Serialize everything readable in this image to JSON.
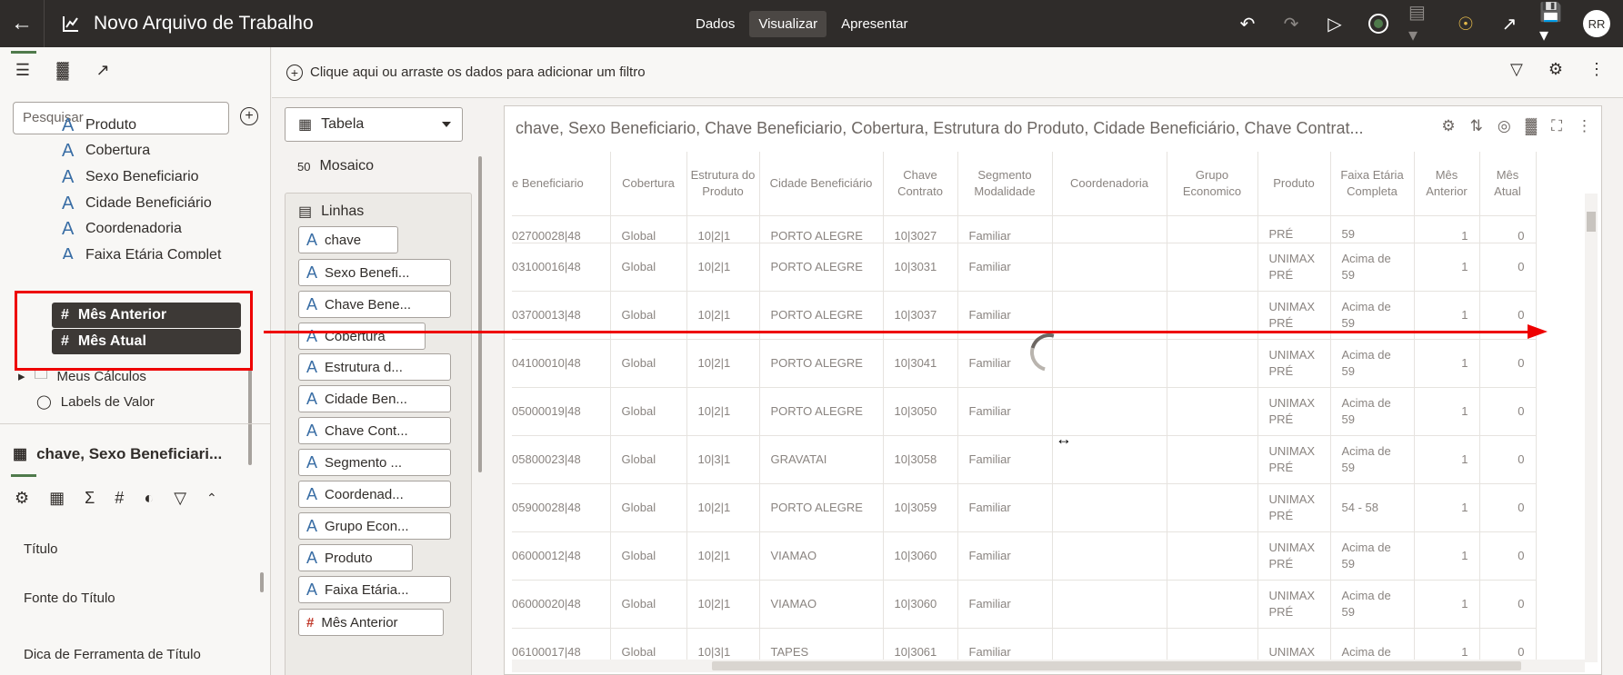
{
  "topbar": {
    "title": "Novo Arquivo de Trabalho",
    "tabs": [
      "Dados",
      "Visualizar",
      "Apresentar"
    ],
    "active_tab": "Visualizar",
    "avatar": "RR"
  },
  "left_panel": {
    "search_placeholder": "Pesquisar",
    "attributes": [
      "Produto",
      "Cobertura",
      "Sexo Beneficiario",
      "Cidade Beneficiário",
      "Coordenadoria",
      "Faixa Etária Complet"
    ],
    "measures": [
      "Mês Anterior",
      "Mês Atual"
    ],
    "folders": [
      "Meus Cálculos",
      "Labels de Valor"
    ],
    "viz_name": "chave, Sexo Beneficiari...",
    "properties": [
      "Título",
      "Fonte do Título",
      "Dica de Ferramenta de Título"
    ]
  },
  "filterbar": {
    "text": "Clique aqui ou arraste os dados para adicionar um filtro"
  },
  "grammar": {
    "viz_type": "Tabela",
    "mosaic_label": "Mosaico",
    "rows_label": "Linhas",
    "row_chips": [
      "chave",
      "Sexo Benefi...",
      "Chave Bene...",
      "Cobertura",
      "Estrutura d...",
      "Cidade Ben...",
      "Chave Cont...",
      "Segmento ...",
      "Coordenad...",
      "Grupo Econ...",
      "Produto",
      "Faixa Etária...",
      "Mês Anterior"
    ]
  },
  "canvas": {
    "title": "chave, Sexo Beneficiario, Chave Beneficiario, Cobertura, Estrutura do Produto, Cidade Beneficiário, Chave Contrat...",
    "columns": [
      {
        "label": "e Beneficiario"
      },
      {
        "label": "Cobertura"
      },
      {
        "label": "Estrutura do Produto"
      },
      {
        "label": "Cidade Beneficiário"
      },
      {
        "label": "Chave Contrato"
      },
      {
        "label": "Segmento Modalidade"
      },
      {
        "label": "Coordenadoria"
      },
      {
        "label": "Grupo Economico"
      },
      {
        "label": "Produto"
      },
      {
        "label": "Faixa Etária Completa"
      },
      {
        "label": "Mês Anterior"
      },
      {
        "label": "Mês Atual"
      }
    ],
    "rows": [
      [
        "02700028|48",
        "Global",
        "10|2|1",
        "PORTO ALEGRE",
        "10|3027",
        "Familiar",
        "",
        "",
        "PRÉ",
        "59",
        "1",
        "0"
      ],
      [
        "03100016|48",
        "Global",
        "10|2|1",
        "PORTO ALEGRE",
        "10|3031",
        "Familiar",
        "",
        "",
        "UNIMAX PRÉ",
        "Acima de 59",
        "1",
        "0"
      ],
      [
        "03700013|48",
        "Global",
        "10|2|1",
        "PORTO ALEGRE",
        "10|3037",
        "Familiar",
        "",
        "",
        "UNIMAX PRÉ",
        "Acima de 59",
        "1",
        "0"
      ],
      [
        "04100010|48",
        "Global",
        "10|2|1",
        "PORTO ALEGRE",
        "10|3041",
        "Familiar",
        "",
        "",
        "UNIMAX PRÉ",
        "Acima de 59",
        "1",
        "0"
      ],
      [
        "05000019|48",
        "Global",
        "10|2|1",
        "PORTO ALEGRE",
        "10|3050",
        "Familiar",
        "",
        "",
        "UNIMAX PRÉ",
        "Acima de 59",
        "1",
        "0"
      ],
      [
        "05800023|48",
        "Global",
        "10|3|1",
        "GRAVATAI",
        "10|3058",
        "Familiar",
        "",
        "",
        "UNIMAX PRÉ",
        "Acima de 59",
        "1",
        "0"
      ],
      [
        "05900028|48",
        "Global",
        "10|2|1",
        "PORTO ALEGRE",
        "10|3059",
        "Familiar",
        "",
        "",
        "UNIMAX PRÉ",
        "54 - 58",
        "1",
        "0"
      ],
      [
        "06000012|48",
        "Global",
        "10|2|1",
        "VIAMAO",
        "10|3060",
        "Familiar",
        "",
        "",
        "UNIMAX PRÉ",
        "Acima de 59",
        "1",
        "0"
      ],
      [
        "06000020|48",
        "Global",
        "10|2|1",
        "VIAMAO",
        "10|3060",
        "Familiar",
        "",
        "",
        "UNIMAX PRÉ",
        "Acima de 59",
        "1",
        "0"
      ],
      [
        "06100017|48",
        "Global",
        "10|3|1",
        "TAPES",
        "10|3061",
        "Familiar",
        "",
        "",
        "UNIMAX",
        "Acima de",
        "1",
        "0"
      ]
    ]
  },
  "colors": {
    "topbar": "#2f2c2a",
    "annotation": "#ee0000",
    "accent": "#4f7a4b"
  }
}
